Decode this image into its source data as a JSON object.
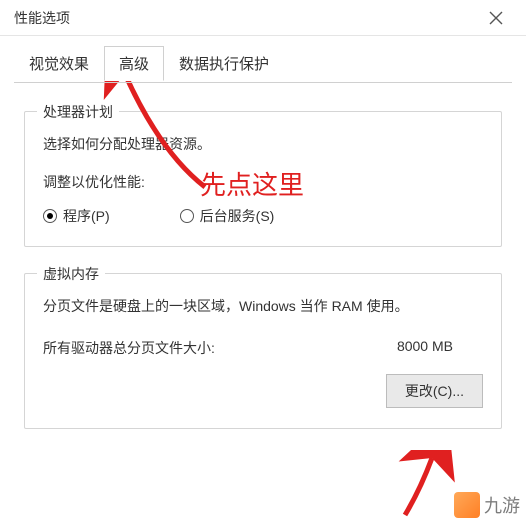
{
  "window": {
    "title": "性能选项"
  },
  "tabs": [
    {
      "label": "视觉效果"
    },
    {
      "label": "高级"
    },
    {
      "label": "数据执行保护"
    }
  ],
  "active_tab_index": 1,
  "processor": {
    "group_title": "处理器计划",
    "desc": "选择如何分配处理器资源。",
    "optimize_label": "调整以优化性能:",
    "radio_programs": "程序(P)",
    "radio_background": "后台服务(S)",
    "selected": "programs"
  },
  "virtual_memory": {
    "group_title": "虚拟内存",
    "desc": "分页文件是硬盘上的一块区域，Windows 当作 RAM 使用。",
    "total_label": "所有驱动器总分页文件大小:",
    "total_value": "8000 MB",
    "change_btn": "更改(C)..."
  },
  "annotations": {
    "click_here": "先点这里"
  },
  "watermark": {
    "text": "九游"
  }
}
